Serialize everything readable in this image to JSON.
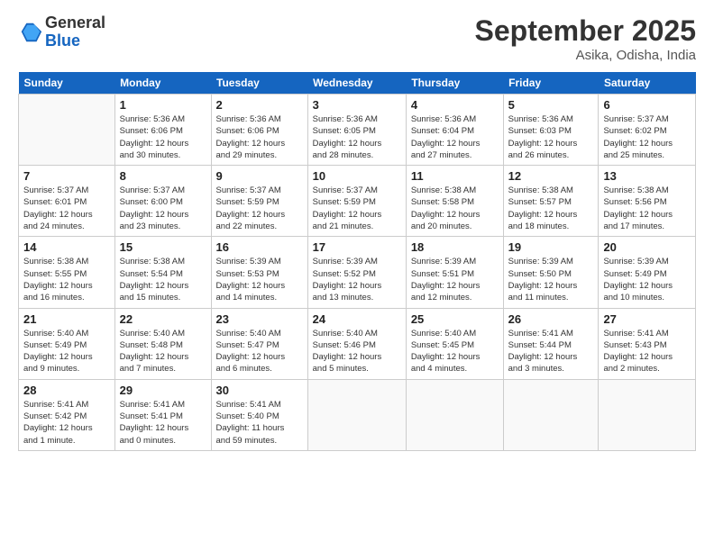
{
  "header": {
    "logo_line1": "General",
    "logo_line2": "Blue",
    "month": "September 2025",
    "location": "Asika, Odisha, India"
  },
  "weekdays": [
    "Sunday",
    "Monday",
    "Tuesday",
    "Wednesday",
    "Thursday",
    "Friday",
    "Saturday"
  ],
  "weeks": [
    [
      {
        "day": "",
        "info": ""
      },
      {
        "day": "1",
        "info": "Sunrise: 5:36 AM\nSunset: 6:06 PM\nDaylight: 12 hours\nand 30 minutes."
      },
      {
        "day": "2",
        "info": "Sunrise: 5:36 AM\nSunset: 6:06 PM\nDaylight: 12 hours\nand 29 minutes."
      },
      {
        "day": "3",
        "info": "Sunrise: 5:36 AM\nSunset: 6:05 PM\nDaylight: 12 hours\nand 28 minutes."
      },
      {
        "day": "4",
        "info": "Sunrise: 5:36 AM\nSunset: 6:04 PM\nDaylight: 12 hours\nand 27 minutes."
      },
      {
        "day": "5",
        "info": "Sunrise: 5:36 AM\nSunset: 6:03 PM\nDaylight: 12 hours\nand 26 minutes."
      },
      {
        "day": "6",
        "info": "Sunrise: 5:37 AM\nSunset: 6:02 PM\nDaylight: 12 hours\nand 25 minutes."
      }
    ],
    [
      {
        "day": "7",
        "info": "Sunrise: 5:37 AM\nSunset: 6:01 PM\nDaylight: 12 hours\nand 24 minutes."
      },
      {
        "day": "8",
        "info": "Sunrise: 5:37 AM\nSunset: 6:00 PM\nDaylight: 12 hours\nand 23 minutes."
      },
      {
        "day": "9",
        "info": "Sunrise: 5:37 AM\nSunset: 5:59 PM\nDaylight: 12 hours\nand 22 minutes."
      },
      {
        "day": "10",
        "info": "Sunrise: 5:37 AM\nSunset: 5:59 PM\nDaylight: 12 hours\nand 21 minutes."
      },
      {
        "day": "11",
        "info": "Sunrise: 5:38 AM\nSunset: 5:58 PM\nDaylight: 12 hours\nand 20 minutes."
      },
      {
        "day": "12",
        "info": "Sunrise: 5:38 AM\nSunset: 5:57 PM\nDaylight: 12 hours\nand 18 minutes."
      },
      {
        "day": "13",
        "info": "Sunrise: 5:38 AM\nSunset: 5:56 PM\nDaylight: 12 hours\nand 17 minutes."
      }
    ],
    [
      {
        "day": "14",
        "info": "Sunrise: 5:38 AM\nSunset: 5:55 PM\nDaylight: 12 hours\nand 16 minutes."
      },
      {
        "day": "15",
        "info": "Sunrise: 5:38 AM\nSunset: 5:54 PM\nDaylight: 12 hours\nand 15 minutes."
      },
      {
        "day": "16",
        "info": "Sunrise: 5:39 AM\nSunset: 5:53 PM\nDaylight: 12 hours\nand 14 minutes."
      },
      {
        "day": "17",
        "info": "Sunrise: 5:39 AM\nSunset: 5:52 PM\nDaylight: 12 hours\nand 13 minutes."
      },
      {
        "day": "18",
        "info": "Sunrise: 5:39 AM\nSunset: 5:51 PM\nDaylight: 12 hours\nand 12 minutes."
      },
      {
        "day": "19",
        "info": "Sunrise: 5:39 AM\nSunset: 5:50 PM\nDaylight: 12 hours\nand 11 minutes."
      },
      {
        "day": "20",
        "info": "Sunrise: 5:39 AM\nSunset: 5:49 PM\nDaylight: 12 hours\nand 10 minutes."
      }
    ],
    [
      {
        "day": "21",
        "info": "Sunrise: 5:40 AM\nSunset: 5:49 PM\nDaylight: 12 hours\nand 9 minutes."
      },
      {
        "day": "22",
        "info": "Sunrise: 5:40 AM\nSunset: 5:48 PM\nDaylight: 12 hours\nand 7 minutes."
      },
      {
        "day": "23",
        "info": "Sunrise: 5:40 AM\nSunset: 5:47 PM\nDaylight: 12 hours\nand 6 minutes."
      },
      {
        "day": "24",
        "info": "Sunrise: 5:40 AM\nSunset: 5:46 PM\nDaylight: 12 hours\nand 5 minutes."
      },
      {
        "day": "25",
        "info": "Sunrise: 5:40 AM\nSunset: 5:45 PM\nDaylight: 12 hours\nand 4 minutes."
      },
      {
        "day": "26",
        "info": "Sunrise: 5:41 AM\nSunset: 5:44 PM\nDaylight: 12 hours\nand 3 minutes."
      },
      {
        "day": "27",
        "info": "Sunrise: 5:41 AM\nSunset: 5:43 PM\nDaylight: 12 hours\nand 2 minutes."
      }
    ],
    [
      {
        "day": "28",
        "info": "Sunrise: 5:41 AM\nSunset: 5:42 PM\nDaylight: 12 hours\nand 1 minute."
      },
      {
        "day": "29",
        "info": "Sunrise: 5:41 AM\nSunset: 5:41 PM\nDaylight: 12 hours\nand 0 minutes."
      },
      {
        "day": "30",
        "info": "Sunrise: 5:41 AM\nSunset: 5:40 PM\nDaylight: 11 hours\nand 59 minutes."
      },
      {
        "day": "",
        "info": ""
      },
      {
        "day": "",
        "info": ""
      },
      {
        "day": "",
        "info": ""
      },
      {
        "day": "",
        "info": ""
      }
    ]
  ]
}
